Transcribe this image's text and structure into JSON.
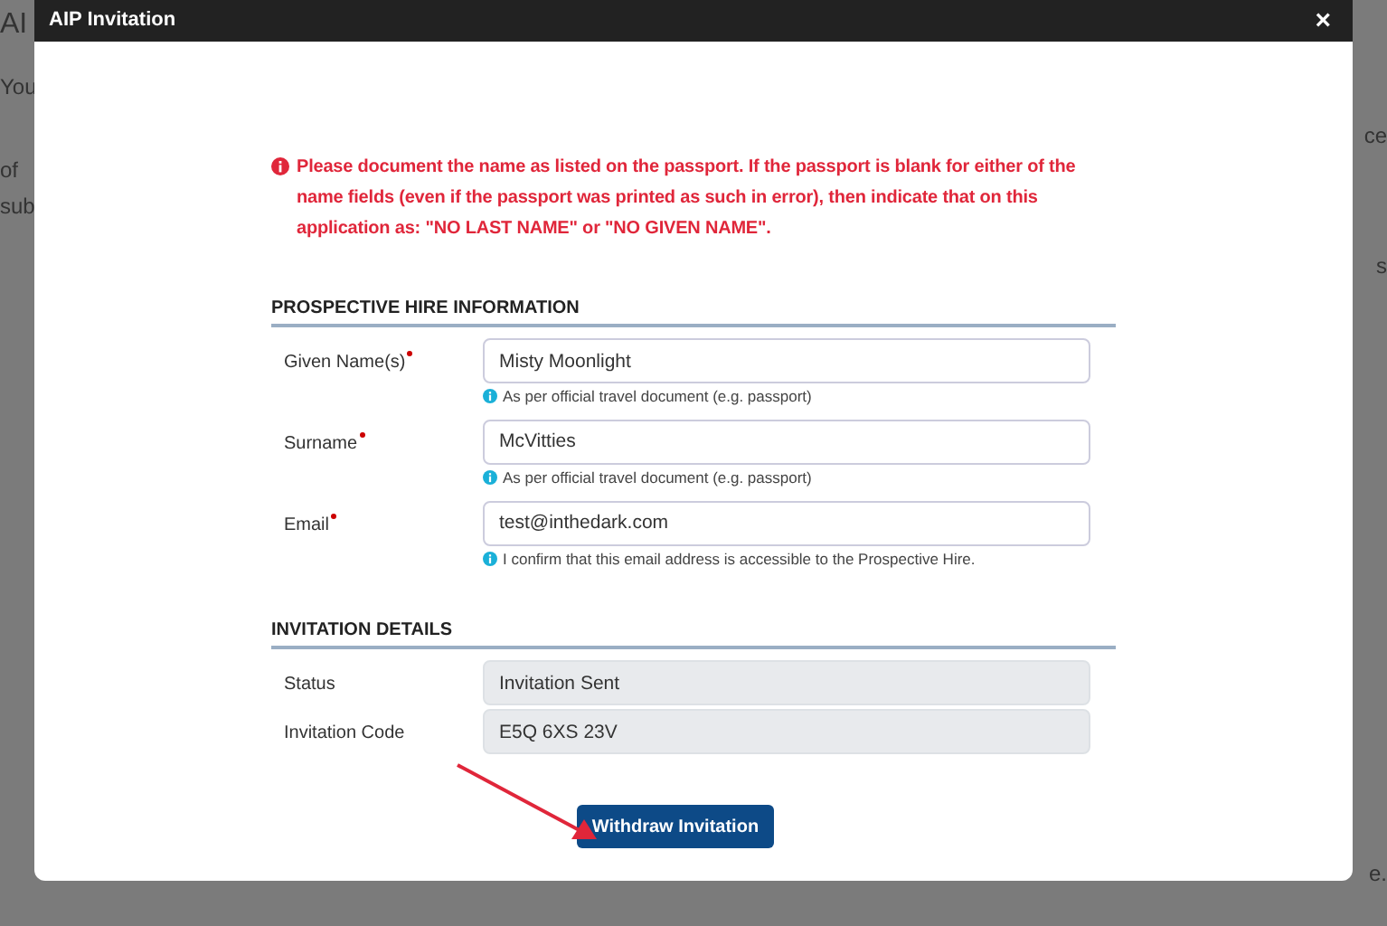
{
  "background_page": {
    "title": "AI",
    "left_fragments": [
      "You",
      "of",
      "sub"
    ],
    "right_fragments": [
      "ce",
      "s",
      "e."
    ]
  },
  "dialog": {
    "title": "AIP Invitation",
    "close": "×",
    "warning": "Please document the name as listed on the passport. If the passport is blank for either of the name fields (even if the passport was printed as such in error), then indicate that on this application as: \"NO LAST NAME\" or \"NO GIVEN NAME\".",
    "sections": [
      {
        "heading": "PROSPECTIVE HIRE INFORMATION",
        "fields": [
          {
            "label": "Given Name(s)",
            "required": true,
            "value": "Misty Moonlight",
            "readonly": false,
            "hint": "As per official travel document (e.g. passport)"
          },
          {
            "label": "Surname",
            "required": true,
            "value": "McVitties",
            "readonly": false,
            "hint": "As per official travel document (e.g. passport)"
          },
          {
            "label": "Email",
            "required": true,
            "value": "test@inthedark.com",
            "readonly": false,
            "hint": "I confirm that this email address is accessible to the Prospective Hire."
          }
        ]
      },
      {
        "heading": "INVITATION DETAILS",
        "fields": [
          {
            "label": "Status",
            "required": false,
            "value": "Invitation Sent",
            "readonly": true
          },
          {
            "label": "Invitation Code",
            "required": false,
            "value": "E5Q 6XS 23V",
            "readonly": true
          }
        ]
      }
    ],
    "button": "Withdraw Invitation"
  }
}
